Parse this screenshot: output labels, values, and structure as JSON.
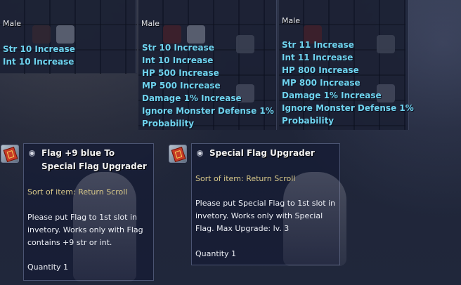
{
  "stat_panels": [
    {
      "gender": "Male",
      "lines": [
        "Str 10 Increase",
        "Int 10 Increase"
      ]
    },
    {
      "gender": "Male",
      "lines": [
        "Str 10 Increase",
        "Int 10 Increase",
        "HP 500 Increase",
        "MP 500 Increase",
        "Damage 1% Increase",
        "Ignore Monster Defense 1%",
        "Probability"
      ]
    },
    {
      "gender": "Male",
      "lines": [
        "Str 11 Increase",
        "Int 11 Increase",
        "HP 800 Increase",
        "MP 800 Increase",
        "Damage 1% Increase",
        "Ignore Monster Defense 1%",
        "Probability"
      ]
    }
  ],
  "items": [
    {
      "icon": "return-scroll-icon",
      "title": "Flag +9 blue To Special Flag Upgrader",
      "sort": "Sort of item: Return Scroll",
      "description": "Please put Flag to 1st slot in invetory. Works only with Flag contains +9 str or int.",
      "quantity": "Quantity 1"
    },
    {
      "icon": "return-scroll-icon",
      "title": "Special Flag Upgrader",
      "sort": "Sort of item: Return Scroll",
      "description": "Please put Special Flag to 1st slot in invetory. Works only with Special Flag. Max Upgrade: lv. 3",
      "quantity": "Quantity 1"
    }
  ],
  "colors": {
    "stat_text": "#6fd3ee",
    "sort_text": "#d9c98a",
    "title_text": "#f2f2f2",
    "panel_bg": "#161c34"
  }
}
